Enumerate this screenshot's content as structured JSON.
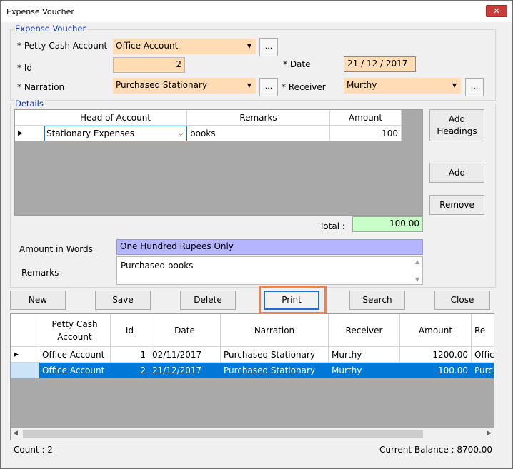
{
  "window": {
    "title": "Expense Voucher",
    "close_glyph": "✕"
  },
  "header": {
    "group_label": "Expense Voucher",
    "petty_cash_label": "* Petty Cash Account",
    "petty_cash_value": "Office Account",
    "id_label": "* Id",
    "id_value": "2",
    "date_label": "* Date",
    "date_value": "21 / 12 / 2017",
    "narration_label": "* Narration",
    "narration_value": "Purchased Stationary",
    "receiver_label": "* Receiver",
    "receiver_value": "Murthy",
    "browse_label": "..."
  },
  "details": {
    "group_label": "Details",
    "columns": [
      "Head of Account",
      "Remarks",
      "Amount"
    ],
    "rows": [
      {
        "head": "Stationary Expenses",
        "remarks": "books",
        "amount": "100"
      }
    ],
    "add_headings_line1": "Add",
    "add_headings_line2": "Headings",
    "add_label": "Add",
    "remove_label": "Remove",
    "total_label": "Total :",
    "total_value": "100.00"
  },
  "words": {
    "label": "Amount in Words",
    "value": "One Hundred  Rupees Only"
  },
  "remarks": {
    "label": "Remarks",
    "value": "Purchased books"
  },
  "actions": {
    "new": "New",
    "save": "Save",
    "delete": "Delete",
    "print": "Print",
    "search": "Search",
    "close": "Close"
  },
  "list": {
    "columns": [
      "Petty Cash Account",
      "Id",
      "Date",
      "Narration",
      "Receiver",
      "Amount",
      "Re"
    ],
    "rows": [
      {
        "account": "Office Account",
        "id": "1",
        "date": "02/11/2017",
        "narration": "Purchased Stationary",
        "receiver": "Murthy",
        "amount": "1200.00",
        "remarks": "Offic"
      },
      {
        "account": "Office Account",
        "id": "2",
        "date": "21/12/2017",
        "narration": "Purchased Stationary",
        "receiver": "Murthy",
        "amount": "100.00",
        "remarks": "Purch"
      }
    ]
  },
  "status": {
    "count": "Count : 2",
    "balance": "Current Balance : 8700.00"
  },
  "colors": {
    "field_bg": "#ffdcb4",
    "total_bg": "#c8ffc8",
    "words_bg": "#b4b4ff",
    "selection": "#0078d7",
    "highlight_border": "#e8845c"
  }
}
